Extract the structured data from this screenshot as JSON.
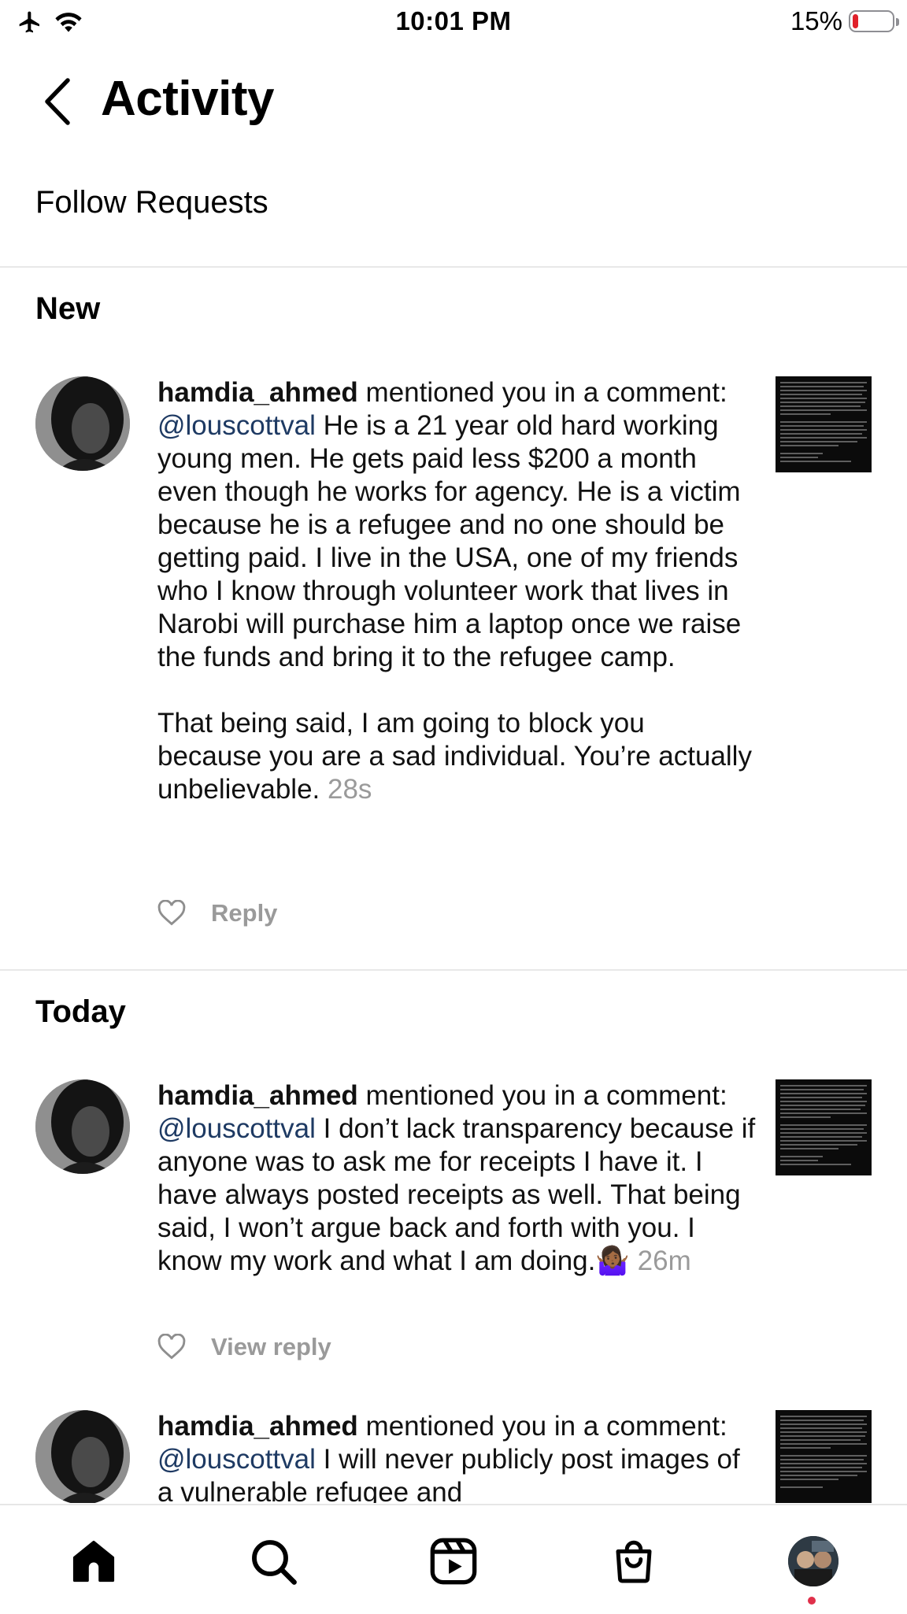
{
  "status_bar": {
    "time": "10:01 PM",
    "battery_percent": "15%",
    "battery_level": 0.15,
    "battery_color": "#e0202a",
    "icons": [
      "airplane-icon",
      "wifi-icon",
      "battery-icon"
    ]
  },
  "header": {
    "title": "Activity",
    "back_icon": "chevron-left-icon"
  },
  "follow_requests_label": "Follow Requests",
  "sections": {
    "new_title": "New",
    "today_title": "Today"
  },
  "notifications": [
    {
      "username": "hamdia_ahmed",
      "action": " mentioned you in a comment: ",
      "mention": "@louscottval",
      "text": "  He is a 21 year old hard working young men. He gets paid less $200 a month even though he works for agency. He is a victim because he is a refugee and no one should be getting paid. I live in the USA, one of my friends who I know through volunteer work that lives in Narobi will purchase him a laptop once we raise the funds and bring it to the refugee camp.",
      "text2": "That being said, I am going to block you because you are a sad individual. You’re actually unbelievable.",
      "time": " 28s",
      "action_label": "Reply"
    },
    {
      "username": "hamdia_ahmed",
      "action": " mentioned you in a comment: ",
      "mention": "@louscottval",
      "text": "  I don’t lack transparency because if anyone was to ask me for receipts I have it. I have always posted receipts as well. That being said, I won’t argue back and forth with you. I know my work and what I am doing.🤷🏾‍♀️",
      "time": " 26m",
      "action_label": "View reply"
    },
    {
      "username": "hamdia_ahmed",
      "action": " mentioned you in a comment: ",
      "mention": "@louscottval",
      "text": "  I will never publicly post images of a vulnerable refugee and"
    }
  ],
  "bottom_nav": {
    "items": [
      "home-icon",
      "search-icon",
      "reels-icon",
      "shop-icon",
      "profile-avatar"
    ],
    "badge_color": "#e0304a"
  }
}
